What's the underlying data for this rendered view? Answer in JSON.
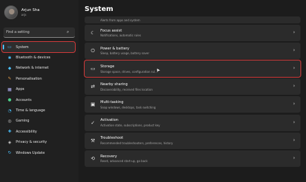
{
  "user": {
    "name": "Arjun Sha",
    "email": "arjs"
  },
  "search": {
    "placeholder": "Find a setting"
  },
  "nav": [
    {
      "label": "System",
      "icon": "monitor-icon",
      "color": "#4cc2ff",
      "glyph": "▭"
    },
    {
      "label": "Bluetooth & devices",
      "icon": "bluetooth-icon",
      "color": "#4cc2ff",
      "glyph": "✱"
    },
    {
      "label": "Network & internet",
      "icon": "network-icon",
      "color": "#4cc2ff",
      "glyph": "◆"
    },
    {
      "label": "Personalisation",
      "icon": "brush-icon",
      "color": "#e8a04c",
      "glyph": "✎"
    },
    {
      "label": "Apps",
      "icon": "apps-icon",
      "color": "#b9b9ff",
      "glyph": "▦"
    },
    {
      "label": "Accounts",
      "icon": "accounts-icon",
      "color": "#4cd08a",
      "glyph": "●"
    },
    {
      "label": "Time & language",
      "icon": "clock-icon",
      "color": "#4cc2ff",
      "glyph": "◔"
    },
    {
      "label": "Gaming",
      "icon": "gamepad-icon",
      "color": "#cfcfcf",
      "glyph": "◎"
    },
    {
      "label": "Accessibility",
      "icon": "accessibility-icon",
      "color": "#4cc2ff",
      "glyph": "✚"
    },
    {
      "label": "Privacy & security",
      "icon": "shield-icon",
      "color": "#cfcfcf",
      "glyph": "◈"
    },
    {
      "label": "Windows Update",
      "icon": "update-icon",
      "color": "#4cc2ff",
      "glyph": "↻"
    }
  ],
  "page_title": "System",
  "items": [
    {
      "title": "",
      "sub": "Alerts from apps and system",
      "icon": "bell-icon",
      "glyph": "",
      "partial": true
    },
    {
      "title": "Focus assist",
      "sub": "Notifications, automatic rules",
      "icon": "moon-icon",
      "glyph": "☾"
    },
    {
      "title": "Power & battery",
      "sub": "Sleep, battery usage, battery saver",
      "icon": "power-icon",
      "glyph": "⏻"
    },
    {
      "title": "Storage",
      "sub": "Storage space, drives, configuration rul...",
      "icon": "drive-icon",
      "glyph": "▭",
      "highlight": true
    },
    {
      "title": "Nearby sharing",
      "sub": "Discoverability, received files location",
      "icon": "share-icon",
      "glyph": "⇄"
    },
    {
      "title": "Multi-tasking",
      "sub": "Snap windows, desktops, task switching",
      "icon": "multitask-icon",
      "glyph": "▣"
    },
    {
      "title": "Activation",
      "sub": "Activation state, subscriptions, product key",
      "icon": "check-icon",
      "glyph": "✓"
    },
    {
      "title": "Troubleshoot",
      "sub": "Recommended troubleshooters, preferences, history",
      "icon": "wrench-icon",
      "glyph": "⚒"
    },
    {
      "title": "Recovery",
      "sub": "Reset, advanced start-up, go back",
      "icon": "recovery-icon",
      "glyph": "⟲"
    }
  ]
}
